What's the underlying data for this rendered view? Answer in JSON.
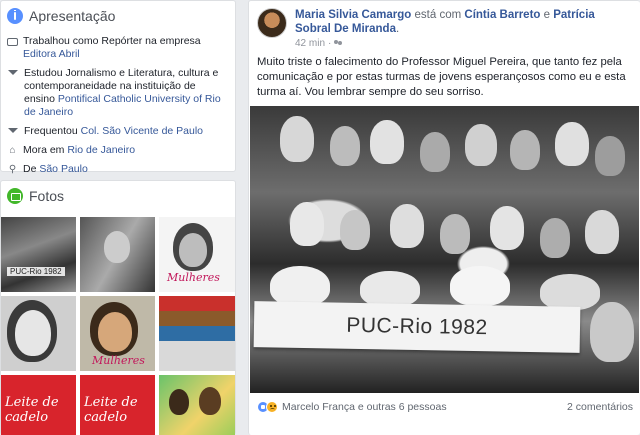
{
  "intro": {
    "title": "Apresentação",
    "items": [
      {
        "icon": "briefcase-icon",
        "text": "Trabalhou como Repórter na empresa ",
        "link": "Editora Abril"
      },
      {
        "icon": "graduation-cap-icon",
        "text": "Estudou Jornalismo e Literatura, cultura e contemporaneidade na instituição de ensino ",
        "link": "Pontifical Catholic University of Rio de Janeiro"
      },
      {
        "icon": "graduation-cap-icon",
        "text": "Frequentou ",
        "link": "Col. São Vicente de Paulo"
      },
      {
        "icon": "home-icon",
        "text": "Mora em ",
        "link": "Rio de Janeiro"
      },
      {
        "icon": "map-pin-icon",
        "text": "De ",
        "link": "São Paulo"
      }
    ]
  },
  "photos": {
    "title": "Fotos",
    "tile_caption": "PUC-Rio 1982",
    "tile_mulheres": "Mulheres",
    "tile_leite": "Leite de cadelo"
  },
  "post": {
    "author": "Maria Silvia Camargo",
    "with_text": " está com ",
    "tag1": "Cíntia Barreto",
    "and_text": " e ",
    "tag2": "Patrícia Sobral De Miranda",
    "period": ".",
    "time": "42 min",
    "dot": "·",
    "body": "Muito triste o falecimento do Professor Miguel Pereira, que tanto fez pela comunicação e por estas turmas de jovens esperançosos como eu e esta turma aí. Vou lembrar sempre do seu sorriso.",
    "photo_banner": "PUC-Rio 1982",
    "reactors": "Marcelo França e outras 6 pessoas",
    "comments": "2 comentários"
  },
  "colors": {
    "accent": "#365899",
    "background": "#e9ebee"
  }
}
